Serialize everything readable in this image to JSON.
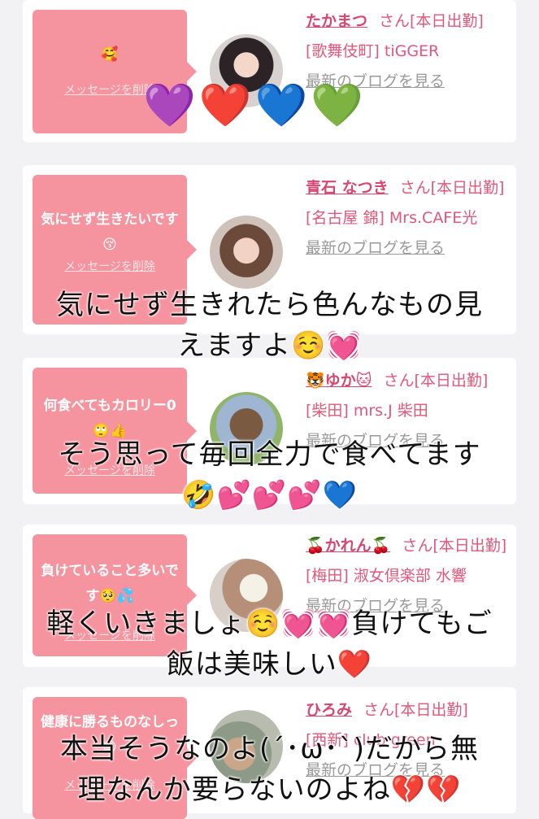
{
  "cards": [
    {
      "message": "🥰",
      "delete_label": "メッセージを削除",
      "name": "たかまつ",
      "suffix": "さん[本日出勤]",
      "shop": "[歌舞伎町] tiGGER",
      "blog_link": "最新のブログを見る"
    },
    {
      "message": "気にせず生きたいです😚",
      "delete_label": "メッセージを削除",
      "name": "青石 なつき",
      "suffix": "さん[本日出勤]",
      "shop": "[名古屋 錦] Mrs.CAFE光",
      "blog_link": "最新のブログを見る"
    },
    {
      "message": "何食べてもカロリー0🙄👍",
      "delete_label": "メッセージを削除",
      "name": "🐯ゆか🐱",
      "suffix": "さん[本日出勤]",
      "shop": "[柴田] mrs.J 柴田",
      "blog_link": "最新のブログを見る"
    },
    {
      "message": "負けていること多いです🥺💦",
      "delete_label": "メッセージを削除",
      "name": "🍒かれん🍒",
      "suffix": "さん[本日出勤]",
      "shop": "[梅田] 淑女倶楽部 水響",
      "blog_link": "最新のブログを見る"
    },
    {
      "message": "健康に勝るものなしっ😊",
      "delete_label": "メッセージを削除",
      "name": "ひろみ",
      "suffix": "さん[本日出勤]",
      "shop": "[西新] club green",
      "blog_link": "最新のブログを見る"
    }
  ],
  "hearts": "💜❤️💙💚",
  "overlays": [
    "気にせず生きれたら色んなもの見",
    "えますよ☺️💓",
    "そう思って毎回全力で食べてます",
    "🤣💕💕💕💙",
    "軽くいきましょ☺️💓💓負けてもご",
    "飯は美味しい❤️",
    "本当そうなのよ(´･ω･`)だから無",
    "理なんか要らないのよね💔💔"
  ],
  "colors": {
    "bubble": "#f5949f",
    "name": "#d94670",
    "text": "#e2577a"
  }
}
